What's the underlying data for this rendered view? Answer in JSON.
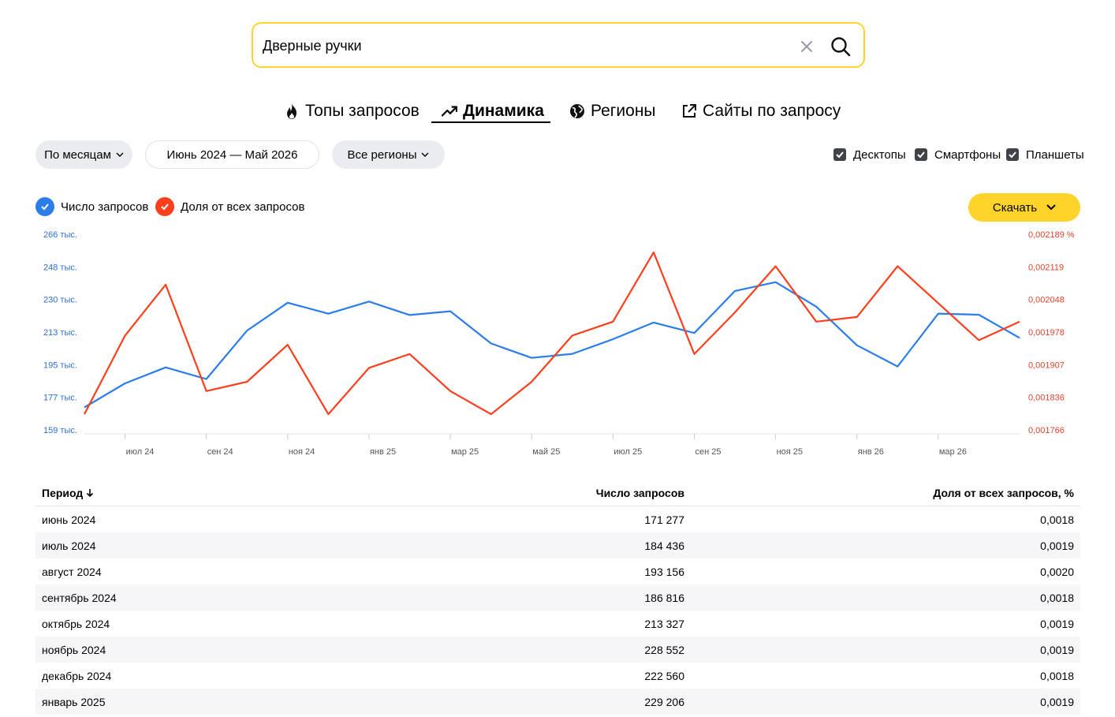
{
  "search": {
    "value": "Дверные ручки"
  },
  "tabs": [
    {
      "label": "Топы запросов",
      "icon": "fire-icon"
    },
    {
      "label": "Динамика",
      "icon": "trend-icon",
      "active": true
    },
    {
      "label": "Регионы",
      "icon": "globe-icon"
    },
    {
      "label": "Сайты по запросу",
      "icon": "external-link-icon"
    }
  ],
  "filters": {
    "group_by": "По месяцам",
    "date_range": "Июнь 2024 — Май 2026",
    "regions": "Все регионы"
  },
  "devices": [
    {
      "label": "Десктопы",
      "checked": true
    },
    {
      "label": "Смартфоны",
      "checked": true
    },
    {
      "label": "Планшеты",
      "checked": true
    }
  ],
  "legend": [
    {
      "label": "Число запросов",
      "color": "#2b7de9"
    },
    {
      "label": "Доля от всех запросов",
      "color": "#fc3f1d"
    }
  ],
  "download_label": "Скачать",
  "chart_data": {
    "type": "line",
    "y_left_ticks": [
      "266 тыс.",
      "248 тыс.",
      "230 тыс.",
      "213 тыс.",
      "195 тыс.",
      "177 тыс.",
      "159 тыс."
    ],
    "y_right_ticks": [
      "0,002189 %",
      "0,002119",
      "0,002048",
      "0,001978",
      "0,001907",
      "0,001836",
      "0,001766"
    ],
    "x_ticks": [
      "июл 24",
      "сен 24",
      "ноя 24",
      "янв 25",
      "мар 25",
      "май 25",
      "июл 25",
      "сен 25",
      "ноя 25",
      "янв 26",
      "мар 26"
    ],
    "x": [
      "июн 2024",
      "июл 2024",
      "авг 2024",
      "сен 2024",
      "окт 2024",
      "ноя 2024",
      "дек 2024",
      "янв 2025",
      "фев 2025",
      "мар 2025",
      "апр 2025",
      "май 2025",
      "июн 2025",
      "июл 2025",
      "авг 2025",
      "сен 2025",
      "окт 2025",
      "ноя 2025",
      "дек 2025",
      "янв 2026",
      "фев 2026",
      "мар 2026",
      "апр 2026",
      "май 2026"
    ],
    "ylim_left": [
      159000,
      266000
    ],
    "ylim_right": [
      0.001766,
      0.002189
    ],
    "series": [
      {
        "name": "Число запросов",
        "axis": "left",
        "color": "#2b7de9",
        "values": [
          171277,
          184436,
          193156,
          186816,
          213327,
          228552,
          222560,
          229206,
          221800,
          223900,
          206300,
          198400,
          200600,
          208600,
          217700,
          212000,
          235000,
          239800,
          226400,
          205300,
          193700,
          222600,
          222000,
          209300
        ]
      },
      {
        "name": "Доля от всех запросов",
        "axis": "right",
        "color": "#fc3f1d",
        "values": [
          0.0018,
          0.00197,
          0.00208,
          0.00185,
          0.00187,
          0.00195,
          0.0018,
          0.0019,
          0.00193,
          0.00185,
          0.0018,
          0.00187,
          0.00197,
          0.002,
          0.00215,
          0.00193,
          0.00202,
          0.00212,
          0.002,
          0.00201,
          0.00212,
          0.00204,
          0.00196,
          0.002
        ]
      }
    ]
  },
  "table": {
    "headers": [
      "Период",
      "Число запросов",
      "Доля от всех запросов, %"
    ],
    "rows": [
      [
        "июнь 2024",
        "171 277",
        "0,0018"
      ],
      [
        "июль 2024",
        "184 436",
        "0,0019"
      ],
      [
        "август 2024",
        "193 156",
        "0,0020"
      ],
      [
        "сентябрь 2024",
        "186 816",
        "0,0018"
      ],
      [
        "октябрь 2024",
        "213 327",
        "0,0019"
      ],
      [
        "ноябрь 2024",
        "228 552",
        "0,0019"
      ],
      [
        "декабрь 2024",
        "222 560",
        "0,0018"
      ],
      [
        "январь 2025",
        "229 206",
        "0,0019"
      ]
    ]
  }
}
